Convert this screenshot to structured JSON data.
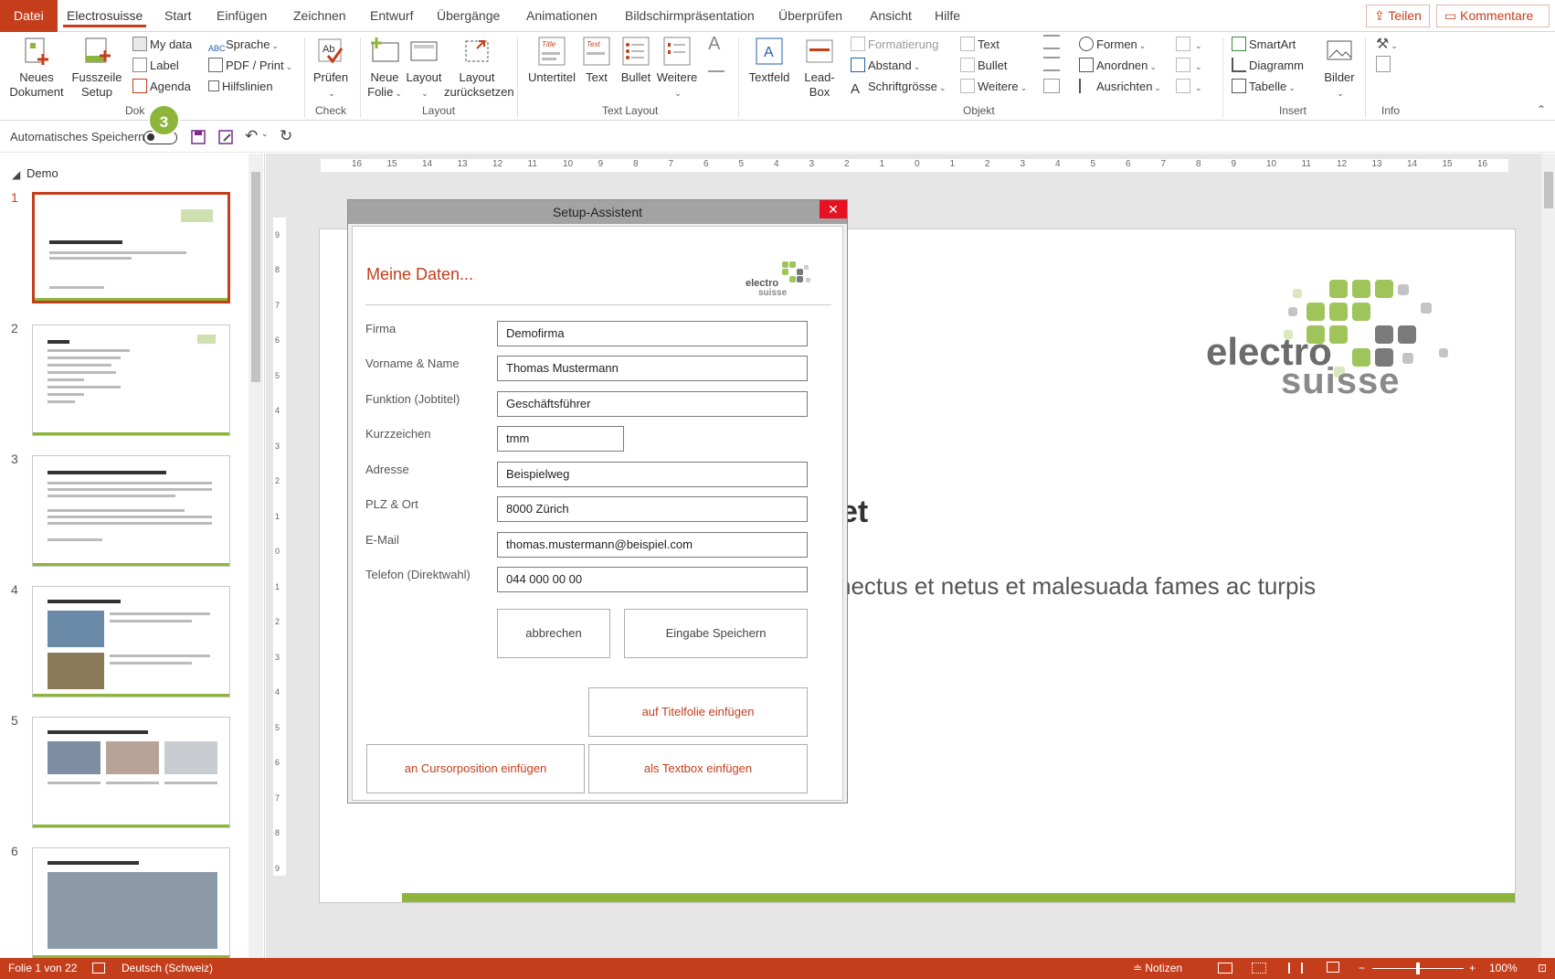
{
  "tabs": [
    "Datei",
    "Electrosuisse",
    "Start",
    "Einfügen",
    "Zeichnen",
    "Entwurf",
    "Übergänge",
    "Animationen",
    "Bildschirmpräsentation",
    "Überprüfen",
    "Ansicht",
    "Hilfe"
  ],
  "share_label": "Teilen",
  "comments_label": "Kommentare",
  "ribbon": {
    "neues_dokument": "Neues Dokument",
    "fusszeile_setup": "Fusszeile Setup",
    "my_data": "My data",
    "label": "Label",
    "agenda": "Agenda",
    "sprache": "Sprache",
    "pdf_print": "PDF / Print",
    "hilfslinien": "Hilfslinien",
    "group_dok": "Dok",
    "pruefen": "Prüfen",
    "group_check": "Check",
    "neue_folie": "Neue Folie",
    "layout": "Layout",
    "layout_reset": "Layout zurücksetzen",
    "group_layout": "Layout",
    "untertitel": "Untertitel",
    "text": "Text",
    "bullet": "Bullet",
    "weitere": "Weitere",
    "group_text_layout": "Text Layout",
    "textfeld": "Textfeld",
    "lead_box": "Lead-Box",
    "formatierung": "Formatierung",
    "abstand": "Abstand",
    "schriftgroesse": "Schriftgrösse",
    "obj_text": "Text",
    "obj_bullet": "Bullet",
    "obj_weitere": "Weitere",
    "formen": "Formen",
    "anordnen": "Anordnen",
    "ausrichten": "Ausrichten",
    "group_objekt": "Objekt",
    "smartart": "SmartArt",
    "diagramm": "Diagramm",
    "tabelle": "Tabelle",
    "bilder": "Bilder",
    "group_insert": "Insert",
    "group_info": "Info",
    "icon_title": "Title",
    "icon_text": "Text",
    "icon_a": "A"
  },
  "qat": {
    "autosave": "Automatisches Speichern",
    "badge": "3"
  },
  "thumbs": {
    "section": "Demo",
    "numbers": [
      "1",
      "2",
      "3",
      "4",
      "5",
      "6"
    ]
  },
  "slide": {
    "title_frag": "et",
    "body_frag": "nectus et netus et malesuada fames ac turpis",
    "logo_top": "electro",
    "logo_bottom": "suisse"
  },
  "dialog": {
    "title": "Setup-Assistent",
    "close": "✕",
    "heading": "Meine Daten...",
    "fields": [
      {
        "label": "Firma",
        "value": "Demofirma"
      },
      {
        "label": "Vorname & Name",
        "value": "Thomas Mustermann"
      },
      {
        "label": "Funktion (Jobtitel)",
        "value": "Geschäftsführer"
      },
      {
        "label": "Kurzzeichen",
        "value": "tmm"
      },
      {
        "label": "Adresse",
        "value": "Beispielweg"
      },
      {
        "label": "PLZ & Ort",
        "value": "8000 Zürich"
      },
      {
        "label": "E-Mail",
        "value": "thomas.mustermann@beispiel.com"
      },
      {
        "label": "Telefon (Direktwahl)",
        "value": "044 000 00 00"
      }
    ],
    "cancel": "abbrechen",
    "save": "Eingabe Speichern",
    "insert_title": "auf Titelfolie einfügen",
    "insert_cursor": "an Cursorposition einfügen",
    "insert_textbox": "als Textbox einfügen"
  },
  "status": {
    "slide_info": "Folie 1 von 22",
    "language": "Deutsch (Schweiz)",
    "notes": "Notizen",
    "zoom": "100%"
  },
  "colors": {
    "accent": "#c43e1c",
    "green": "#8db53c",
    "gray": "#7a7a7a"
  }
}
